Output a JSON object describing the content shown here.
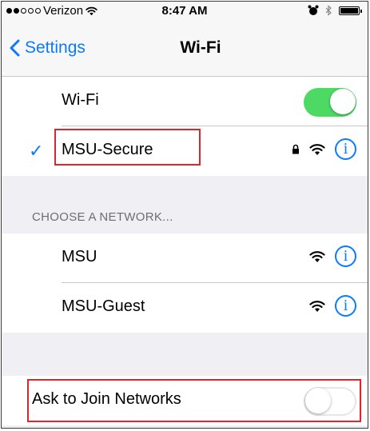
{
  "status_bar": {
    "carrier": "Verizon",
    "time": "8:47 AM"
  },
  "nav": {
    "back_label": "Settings",
    "title": "Wi-Fi"
  },
  "wifi": {
    "label": "Wi-Fi",
    "enabled": true
  },
  "current_network": {
    "name": "MSU-Secure",
    "secured": true
  },
  "choose_network": {
    "header": "CHOOSE A NETWORK...",
    "networks": [
      {
        "name": "MSU"
      },
      {
        "name": "MSU-Guest"
      }
    ]
  },
  "ask_to_join": {
    "label": "Ask to Join Networks",
    "enabled": false
  },
  "colors": {
    "accent": "#0a7aff",
    "toggle_on": "#4cd964",
    "highlight": "#e0242a"
  }
}
